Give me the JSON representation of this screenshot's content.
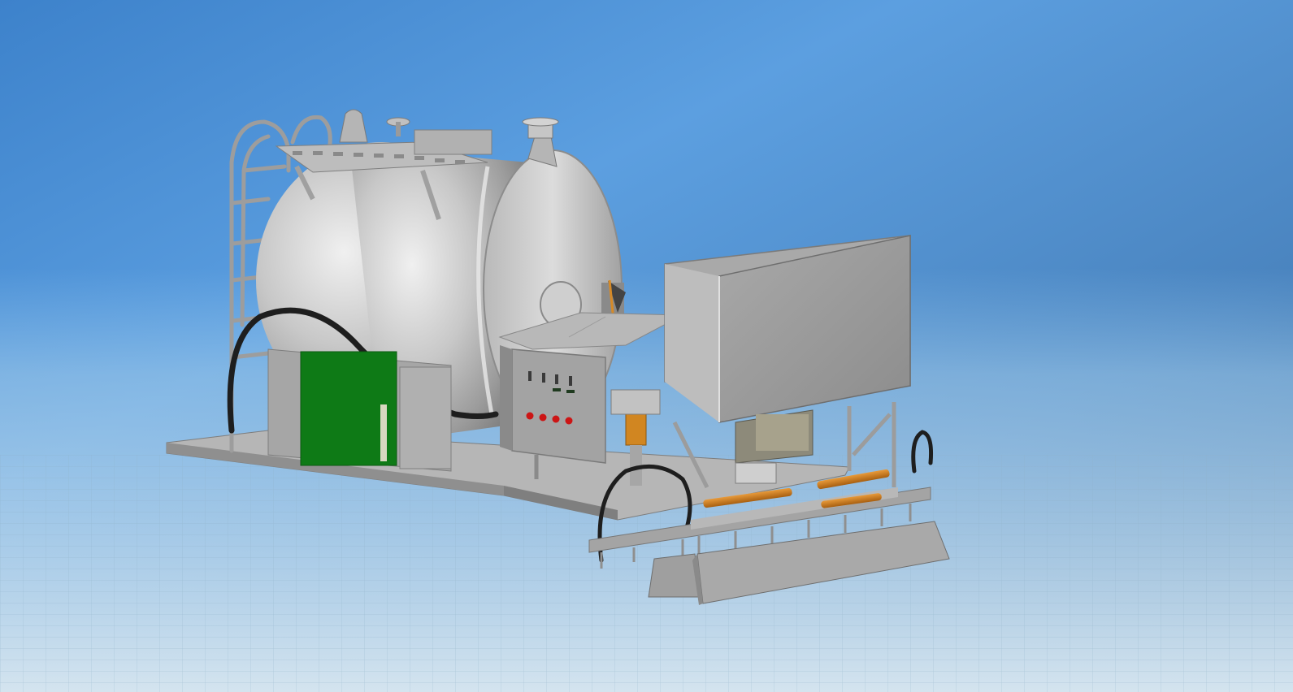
{
  "viewport": {
    "background_top": "#4b8fd3",
    "background_mid": "#78b1e6",
    "background_bottom": "#cfe2f2",
    "background_right": "#2f5f8e",
    "grid_color": "#8fb3c8"
  },
  "model": {
    "tank_color": "#c7c7c7",
    "frame_color": "#a8a8a8",
    "panel_color": "#9a9a9a",
    "green_plate_color": "#0f7a17",
    "hose_color": "#1a1a1a",
    "cylinder_color": "#c9781b",
    "indicator_color": "#cc1515"
  }
}
